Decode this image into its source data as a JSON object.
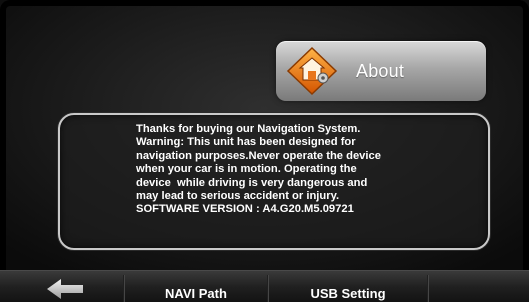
{
  "header": {
    "title": "About",
    "icon": "home-settings-icon"
  },
  "info": {
    "text": "Thanks for buying our Navigation System.\nWarning: This unit has been designed for\nnavigation purposes.Never operate the device\nwhen your car is in motion. Operating the\ndevice  while driving is very dangerous and\nmay lead to serious accident or injury.\nSOFTWARE VERSION : A4.G20.M5.09721"
  },
  "bottom_bar": {
    "back_icon": "back-arrow-icon",
    "navi_path_label": "NAVI Path",
    "usb_setting_label": "USB Setting"
  },
  "colors": {
    "background": "#1b1b1b",
    "tile": "#a7a7a7",
    "icon_orange": "#e8761c",
    "text": "#ffffff"
  }
}
